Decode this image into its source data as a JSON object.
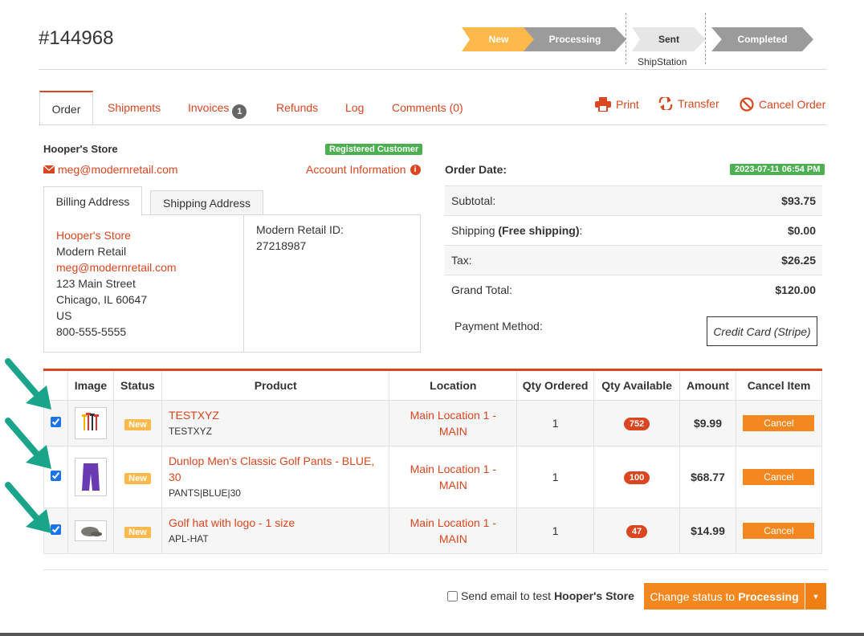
{
  "order": {
    "number": "#144968"
  },
  "pipeline": {
    "steps": [
      "New",
      "Processing",
      "Sent",
      "Completed"
    ],
    "shipstation_label": "ShipStation"
  },
  "tabs": {
    "order": "Order",
    "shipments": "Shipments",
    "invoices": "Invoices",
    "invoices_count": "1",
    "refunds": "Refunds",
    "log": "Log",
    "comments": "Comments (0)"
  },
  "actions": {
    "print": "Print",
    "transfer": "Transfer",
    "cancel_order": "Cancel Order"
  },
  "customer": {
    "store_name": "Hooper's Store",
    "badge": "Registered Customer",
    "email": "meg@modernretail.com",
    "account_info": "Account Information"
  },
  "address_tabs": {
    "billing": "Billing Address",
    "shipping": "Shipping Address"
  },
  "billing": {
    "name": "Hooper's Store",
    "company": "Modern Retail",
    "email": "meg@modernretail.com",
    "street": "123 Main Street",
    "city": "Chicago, IL 60647",
    "country": "US",
    "phone": "800-555-5555",
    "modern_retail_id_label": "Modern Retail ID:",
    "modern_retail_id": "27218987"
  },
  "summary": {
    "order_date_label": "Order Date:",
    "order_date": "2023-07-11 06:54 PM",
    "subtotal_label": "Subtotal:",
    "subtotal": "$93.75",
    "shipping_label": "Shipping",
    "shipping_note": "(Free shipping)",
    "shipping_colon": ":",
    "shipping": "$0.00",
    "tax_label": "Tax:",
    "tax": "$26.25",
    "grand_total_label": "Grand Total:",
    "grand_total": "$120.00",
    "payment_method_label": "Payment Method:",
    "payment_method": "Credit Card (Stripe)"
  },
  "items_table": {
    "headers": [
      "Image",
      "Status",
      "Product",
      "Location",
      "Qty Ordered",
      "Qty Available",
      "Amount",
      "Cancel Item"
    ],
    "rows": [
      {
        "checked": true,
        "status": "New",
        "name": "TESTXYZ",
        "sku": "TESTXYZ",
        "location": "Main Location 1 - MAIN",
        "qty_ordered": "1",
        "qty_available": "752",
        "amount": "$9.99",
        "cancel": "Cancel",
        "image": "golf-tees-icon"
      },
      {
        "checked": true,
        "status": "New",
        "name": "Dunlop Men's Classic Golf Pants - BLUE, 30",
        "sku": "PANTS|BLUE|30",
        "location": "Main Location 1 - MAIN",
        "qty_ordered": "1",
        "qty_available": "100",
        "amount": "$68.77",
        "cancel": "Cancel",
        "image": "purple-pants-icon"
      },
      {
        "checked": true,
        "status": "New",
        "name": "Golf hat with logo - 1 size",
        "sku": "APL-HAT",
        "location": "Main Location 1 - MAIN",
        "qty_ordered": "1",
        "qty_available": "47",
        "amount": "$14.99",
        "cancel": "Cancel",
        "image": "flat-cap-icon"
      }
    ]
  },
  "footer": {
    "send_email_text": "Send email to test",
    "send_email_store": "Hooper's Store",
    "change_status_text": "Change status to",
    "change_status_target": "Processing"
  },
  "colors": {
    "accent": "#d9461f",
    "new_badge": "#fdb94b",
    "registered_badge": "#4caf50",
    "cancel_button": "#f4881f",
    "annotation_arrow": "#1aa58a"
  }
}
